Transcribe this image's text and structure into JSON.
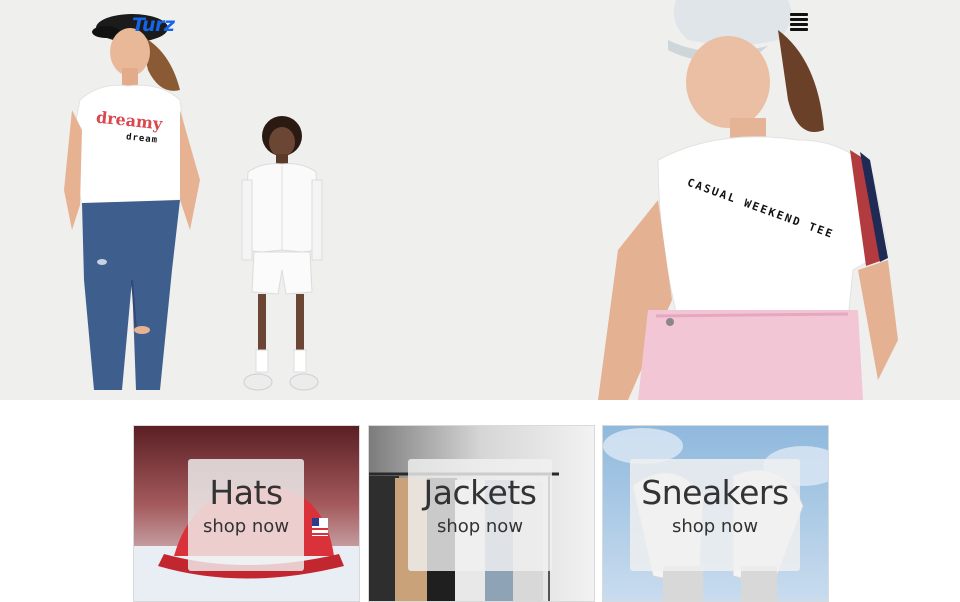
{
  "header": {
    "logo_text": "Turz",
    "menu_icon": "hamburger-menu-icon"
  },
  "hero": {
    "shirt_left_line1": "dreamy",
    "shirt_left_line2": "dream",
    "shirt_right_text": "CASUAL WEEKEND TEE"
  },
  "categories": [
    {
      "title": "Hats",
      "cta": "shop now"
    },
    {
      "title": "Jackets",
      "cta": "shop now"
    },
    {
      "title": "Sneakers",
      "cta": "shop now"
    }
  ],
  "colors": {
    "logo": "#1565e8",
    "hero_background": "#efefee",
    "cap_red": "#d9323b"
  }
}
